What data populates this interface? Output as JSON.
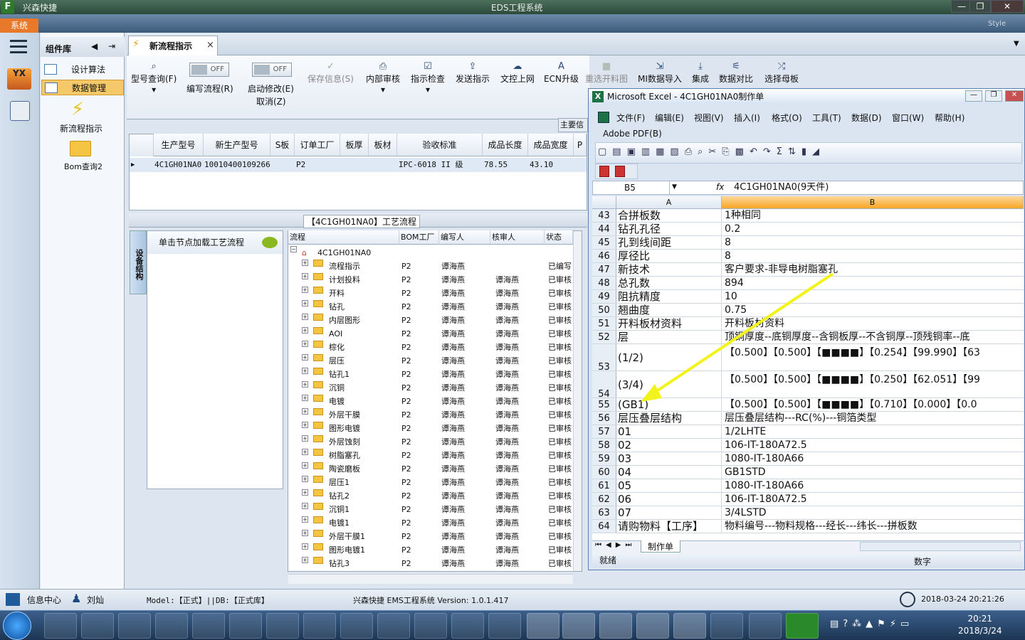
{
  "window": {
    "app_name": "兴森快捷",
    "title": "EDS工程系统",
    "min": "—",
    "max": "❐",
    "close": "✕",
    "style_label": "Style"
  },
  "system_button": "系统",
  "component_library": {
    "title": "组件库",
    "items": [
      {
        "label": "设计算法"
      },
      {
        "label": "数据管理"
      }
    ],
    "big_items": [
      {
        "label": "新流程指示"
      },
      {
        "label": "Bom查询2"
      }
    ]
  },
  "tab": {
    "label": "新流程指示",
    "close": "×"
  },
  "ribbon": {
    "model_query": "型号查询(F)",
    "edit_flow": "编写流程(R)",
    "edit_flow_toggle": "OFF",
    "enable_edit": "启动修改(E)",
    "enable_edit_toggle": "OFF",
    "cancel": "取消(Z)",
    "save_info": "保存信息(S)",
    "internal_review": "内部审核",
    "indicator_check": "指示检查",
    "send_indicator": "发送指示",
    "doc_upload": "文控上网",
    "ecn_upgrade": "ECN升级",
    "reselect_chart": "重选开料图",
    "mi_import": "MI数据导入",
    "integrate": "集成",
    "data_compare": "数据对比",
    "select_master": "选择母板",
    "main_info": "主要信"
  },
  "grid": {
    "headers": [
      "生产型号",
      "新生产型号",
      "S板",
      "订单工厂",
      "板厚",
      "板材",
      "验收标准",
      "成品长度",
      "成品宽度",
      "P"
    ],
    "row": [
      "4C1GH01NA0",
      "10010400109266",
      "",
      "P2",
      "",
      "",
      "IPC-6018 II 级",
      "78.55",
      "43.10",
      ""
    ]
  },
  "process": {
    "title": "【4C1GH01NA0】工艺流程",
    "side_tab": "设备结构",
    "node_header": "单击节点加载工艺流程",
    "columns": [
      "流程",
      "BOM工厂",
      "编写人",
      "核审人",
      "状态"
    ],
    "root": "4C1GH01NA0",
    "rows": [
      [
        "流程指示",
        "P2",
        "谭海燕",
        "",
        "已编写"
      ],
      [
        "计划投料",
        "P2",
        "谭海燕",
        "谭海燕",
        "已审核"
      ],
      [
        "开料",
        "P2",
        "谭海燕",
        "谭海燕",
        "已审核"
      ],
      [
        "钻孔",
        "P2",
        "谭海燕",
        "谭海燕",
        "已审核"
      ],
      [
        "内层图形",
        "P2",
        "谭海燕",
        "谭海燕",
        "已审核"
      ],
      [
        "AOI",
        "P2",
        "谭海燕",
        "谭海燕",
        "已审核"
      ],
      [
        "棕化",
        "P2",
        "谭海燕",
        "谭海燕",
        "已审核"
      ],
      [
        "层压",
        "P2",
        "谭海燕",
        "谭海燕",
        "已审核"
      ],
      [
        "钻孔1",
        "P2",
        "谭海燕",
        "谭海燕",
        "已审核"
      ],
      [
        "沉铜",
        "P2",
        "谭海燕",
        "谭海燕",
        "已审核"
      ],
      [
        "电镀",
        "P2",
        "谭海燕",
        "谭海燕",
        "已审核"
      ],
      [
        "外层干膜",
        "P2",
        "谭海燕",
        "谭海燕",
        "已审核"
      ],
      [
        "图形电镀",
        "P2",
        "谭海燕",
        "谭海燕",
        "已审核"
      ],
      [
        "外层蚀刻",
        "P2",
        "谭海燕",
        "谭海燕",
        "已审核"
      ],
      [
        "树脂塞孔",
        "P2",
        "谭海燕",
        "谭海燕",
        "已审核"
      ],
      [
        "陶瓷磨板",
        "P2",
        "谭海燕",
        "谭海燕",
        "已审核"
      ],
      [
        "层压1",
        "P2",
        "谭海燕",
        "谭海燕",
        "已审核"
      ],
      [
        "钻孔2",
        "P2",
        "谭海燕",
        "谭海燕",
        "已审核"
      ],
      [
        "沉铜1",
        "P2",
        "谭海燕",
        "谭海燕",
        "已审核"
      ],
      [
        "电镀1",
        "P2",
        "谭海燕",
        "谭海燕",
        "已审核"
      ],
      [
        "外层干膜1",
        "P2",
        "谭海燕",
        "谭海燕",
        "已审核"
      ],
      [
        "图形电镀1",
        "P2",
        "谭海燕",
        "谭海燕",
        "已审核"
      ],
      [
        "钻孔3",
        "P2",
        "谭海燕",
        "谭海燕",
        "已审核"
      ]
    ]
  },
  "excel": {
    "title": "Microsoft Excel - 4C1GH01NA0制作单",
    "menus": [
      "文件(F)",
      "编辑(E)",
      "视图(V)",
      "插入(I)",
      "格式(O)",
      "工具(T)",
      "数据(D)",
      "窗口(W)",
      "帮助(H)"
    ],
    "adobe": "Adobe PDF(B)",
    "name_box": "B5",
    "fx": "fx",
    "formula": "4C1GH01NA0(9天件)",
    "col_a": "A",
    "col_b": "B",
    "rows": [
      {
        "n": "43",
        "a": "合拼板数",
        "b": "1种相同"
      },
      {
        "n": "44",
        "a": "钻孔孔径",
        "b": "0.2"
      },
      {
        "n": "45",
        "a": "孔到线间距",
        "b": "8"
      },
      {
        "n": "46",
        "a": "厚径比",
        "b": "8"
      },
      {
        "n": "47",
        "a": "新技术",
        "b": "客户要求-非导电树脂塞孔"
      },
      {
        "n": "48",
        "a": "总孔数",
        "b": "894"
      },
      {
        "n": "49",
        "a": "阻抗精度",
        "b": "10"
      },
      {
        "n": "50",
        "a": "翘曲度",
        "b": "0.75"
      },
      {
        "n": "51",
        "a": "开料板材资料",
        "b": "开料板材资料"
      },
      {
        "n": "52",
        "a": "层",
        "b": "顶铜厚度--底铜厚度--含铜板厚--不含铜厚--顶残铜率--底"
      },
      {
        "n": "53",
        "a": "(1/2)",
        "b": "【0.500】【0.500】【■■■■】【0.254】【99.990】【63"
      },
      {
        "n": "54",
        "a": "(3/4)",
        "b": "【0.500】【0.500】【■■■■】【0.250】【62.051】【99"
      },
      {
        "n": "55",
        "a": "(GB1)",
        "b": "【0.500】【0.500】【■■■■】【0.710】【0.000】【0.0"
      },
      {
        "n": "56",
        "a": "层压叠层结构",
        "b": "层压叠层结构---RC(%)---铜箔类型"
      },
      {
        "n": "57",
        "a": "01",
        "b": "1/2LHTE"
      },
      {
        "n": "58",
        "a": "02",
        "b": "106-IT-180A72.5"
      },
      {
        "n": "59",
        "a": "03",
        "b": "1080-IT-180A66"
      },
      {
        "n": "60",
        "a": "04",
        "b": "GB1STD"
      },
      {
        "n": "61",
        "a": "05",
        "b": "1080-IT-180A66"
      },
      {
        "n": "62",
        "a": "06",
        "b": "106-IT-180A72.5"
      },
      {
        "n": "63",
        "a": "07",
        "b": "3/4LSTD"
      },
      {
        "n": "64",
        "a": "请购物料【工序】",
        "b": "物料编号---物料规格---经长---纬长---拼板数"
      }
    ],
    "sheet_tab": "制作单",
    "status": "就绪",
    "status_right": "数字"
  },
  "statusbar": {
    "info_center": "信息中心",
    "user": "刘灿",
    "model": "Model:【正式】||DB:【正式库】",
    "version": "兴森快捷 EMS工程系统 Version: 1.0.1.417",
    "datetime": "2018-03-24 20:21:26"
  },
  "taskbar": {
    "time": "20:21",
    "date": "2018/3/24"
  },
  "colors": {
    "accent": "#e8792a",
    "arrow": "#f2f21c",
    "excel_green": "#1e7145"
  }
}
